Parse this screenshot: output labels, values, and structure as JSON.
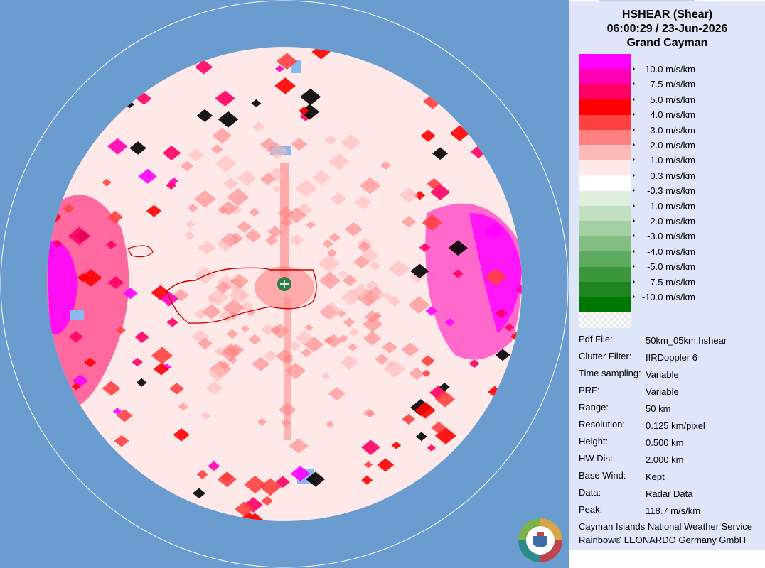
{
  "header": {
    "product": "HSHEAR (Shear)",
    "datetime": "06:00:29 / 23-Jun-2026",
    "site": "Grand Cayman"
  },
  "legend": {
    "unit": "m/s/km",
    "entries": [
      {
        "label": "10.0 m/s/km",
        "color": "#ff00ff"
      },
      {
        "label": "7.5 m/s/km",
        "color": "#ff00b4"
      },
      {
        "label": "5.0 m/s/km",
        "color": "#ff0064"
      },
      {
        "label": "4.0 m/s/km",
        "color": "#ff0000"
      },
      {
        "label": "3.0 m/s/km",
        "color": "#ff4040"
      },
      {
        "label": "2.0 m/s/km",
        "color": "#ff8080"
      },
      {
        "label": "1.0 m/s/km",
        "color": "#ffb8b8"
      },
      {
        "label": "0.3 m/s/km",
        "color": "#ffe8e8"
      },
      {
        "label": "-0.3 m/s/km",
        "color": "#ffffff"
      },
      {
        "label": "-1.0 m/s/km",
        "color": "#e0eee0"
      },
      {
        "label": "-2.0 m/s/km",
        "color": "#c2e0c2"
      },
      {
        "label": "-3.0 m/s/km",
        "color": "#a2d0a2"
      },
      {
        "label": "-4.0 m/s/km",
        "color": "#82be82"
      },
      {
        "label": "-5.0 m/s/km",
        "color": "#5eaa5e"
      },
      {
        "label": "-7.5 m/s/km",
        "color": "#3c963c"
      },
      {
        "label": "-10.0 m/s/km",
        "color": "#1f861f"
      }
    ],
    "bottom_color": "#007800"
  },
  "info": [
    {
      "key": "Pdf File:",
      "value": "50km_05km.hshear"
    },
    {
      "key": "Clutter Filter:",
      "value": "IIRDoppler 6"
    },
    {
      "key": "Time sampling:",
      "value": "Variable"
    },
    {
      "key": "PRF:",
      "value": "Variable"
    },
    {
      "key": "Range:",
      "value": "50 km"
    },
    {
      "key": "Resolution:",
      "value": "0.125 km/pixel"
    },
    {
      "key": "Height:",
      "value": "0.500 km"
    },
    {
      "key": "HW Dist:",
      "value": "2.000 km"
    },
    {
      "key": "Base Wind:",
      "value": "Kept"
    },
    {
      "key": "Data:",
      "value": "Radar Data"
    },
    {
      "key": "Peak:",
      "value": "118.7 m/s/km"
    }
  ],
  "footer": {
    "line1": "Cayman Islands National Weather Service",
    "line2": "Rainbow® LEONARDO Germany GmbH"
  },
  "colors": {
    "background": "#6a9ccf",
    "panel": "#dfe6f9",
    "radar_fill": "#ffe8e8",
    "coastline": "#cc0000",
    "radar_site": "#2e7d46"
  },
  "icons": {
    "radar_site": "radar-site-icon",
    "logo": "cayman-nws-logo"
  }
}
